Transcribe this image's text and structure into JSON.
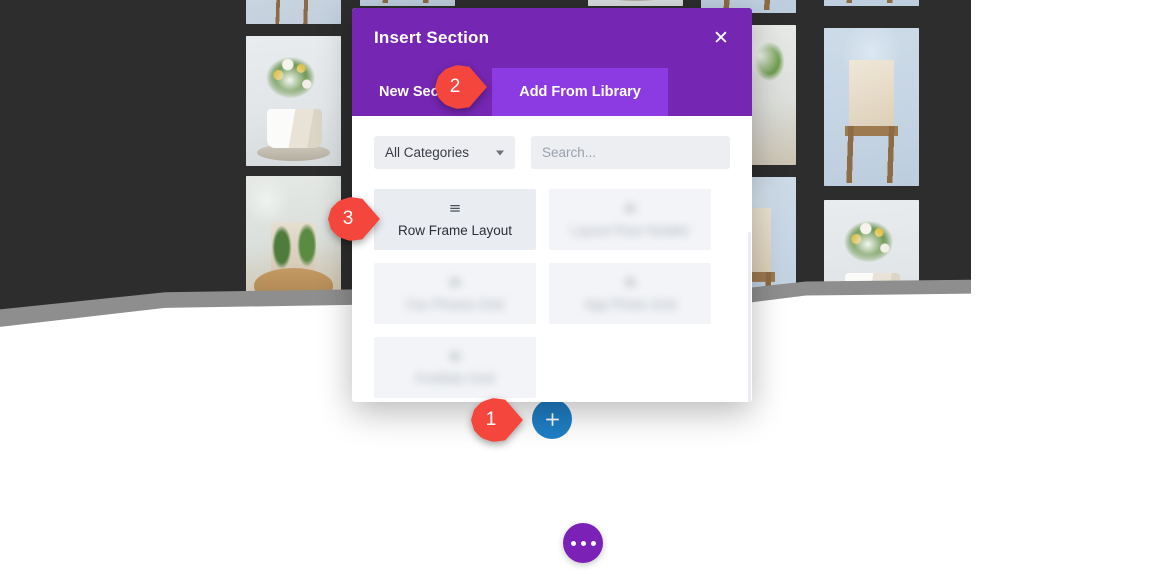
{
  "page": {
    "background_dark": "#2d2d2d",
    "accent_purple": "#7526b3",
    "accent_purple_active": "#8c3ae2",
    "marker_red": "#f4463c",
    "add_button_blue": "#1f7ec4"
  },
  "modal": {
    "title": "Insert Section",
    "close_label": "✕",
    "tabs": [
      {
        "label": "New Section",
        "active": false
      },
      {
        "label": "Add From Library",
        "active": true
      }
    ],
    "filters": {
      "category_selected": "All Categories",
      "category_caret": "chevron-down-icon",
      "search_value": "",
      "search_placeholder": "Search..."
    },
    "layouts": [
      {
        "label": "Row Frame Layout",
        "icon": "≡",
        "blurred": false
      },
      {
        "label": "Layout Row Header",
        "icon": "≡",
        "blurred": true
      },
      {
        "label": "Our Photos Grid",
        "icon": "≡",
        "blurred": true
      },
      {
        "label": "App Photo Grid",
        "icon": "≡",
        "blurred": true
      },
      {
        "label": "Portfolio Grid",
        "icon": "≡",
        "blurred": true
      }
    ]
  },
  "markers": [
    {
      "id": "1",
      "label": "1"
    },
    {
      "id": "2",
      "label": "2"
    },
    {
      "id": "3",
      "label": "3"
    }
  ],
  "buttons": {
    "add_section": "+",
    "page_settings": "…"
  },
  "gallery": {
    "photos": [
      {
        "name": "wooden-stool-photo"
      },
      {
        "name": "white-bouquet-pumpkin-photo"
      },
      {
        "name": "gold-tray-plants-photo"
      },
      {
        "name": "canvas-bag-stool-photo"
      },
      {
        "name": "greenery-shelf-photo"
      },
      {
        "name": "tall-bag-stool-photo"
      },
      {
        "name": "sunflower-bouquet-photo"
      }
    ]
  }
}
